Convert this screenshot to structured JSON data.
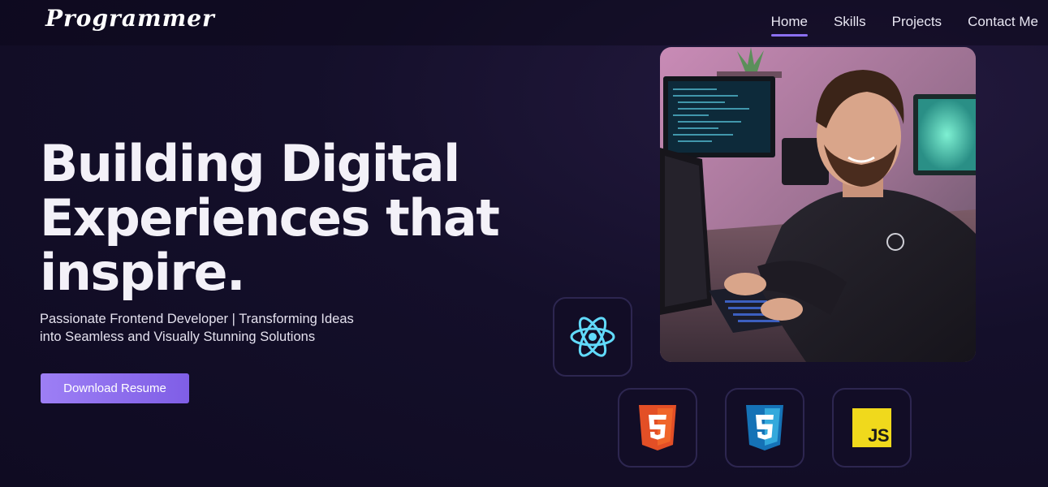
{
  "nav": {
    "logo": "Programmer",
    "links": [
      "Home",
      "Skills",
      "Projects",
      "Contact Me"
    ],
    "active_link": "Home"
  },
  "hero": {
    "title_line1": "Building Digital",
    "title_line2": "Experiences that",
    "title_line3": "inspire.",
    "subtitle_line1": "Passionate Frontend Developer | Transforming Ideas",
    "subtitle_line2": "into Seamless and Visually Stunning Solutions",
    "button_label": "Download Resume"
  },
  "tech_icons": [
    {
      "name": "react-icon",
      "color": "#61dafb"
    },
    {
      "name": "html5-icon",
      "color": "#e34f26"
    },
    {
      "name": "css3-icon",
      "color": "#1572b6"
    },
    {
      "name": "javascript-icon",
      "color": "#f0d91c",
      "label": "JS"
    }
  ],
  "colors": {
    "accent": "#8b6ff0",
    "background": "#140f2a",
    "button_start": "#9d7ff5",
    "button_end": "#7f5ee6"
  }
}
